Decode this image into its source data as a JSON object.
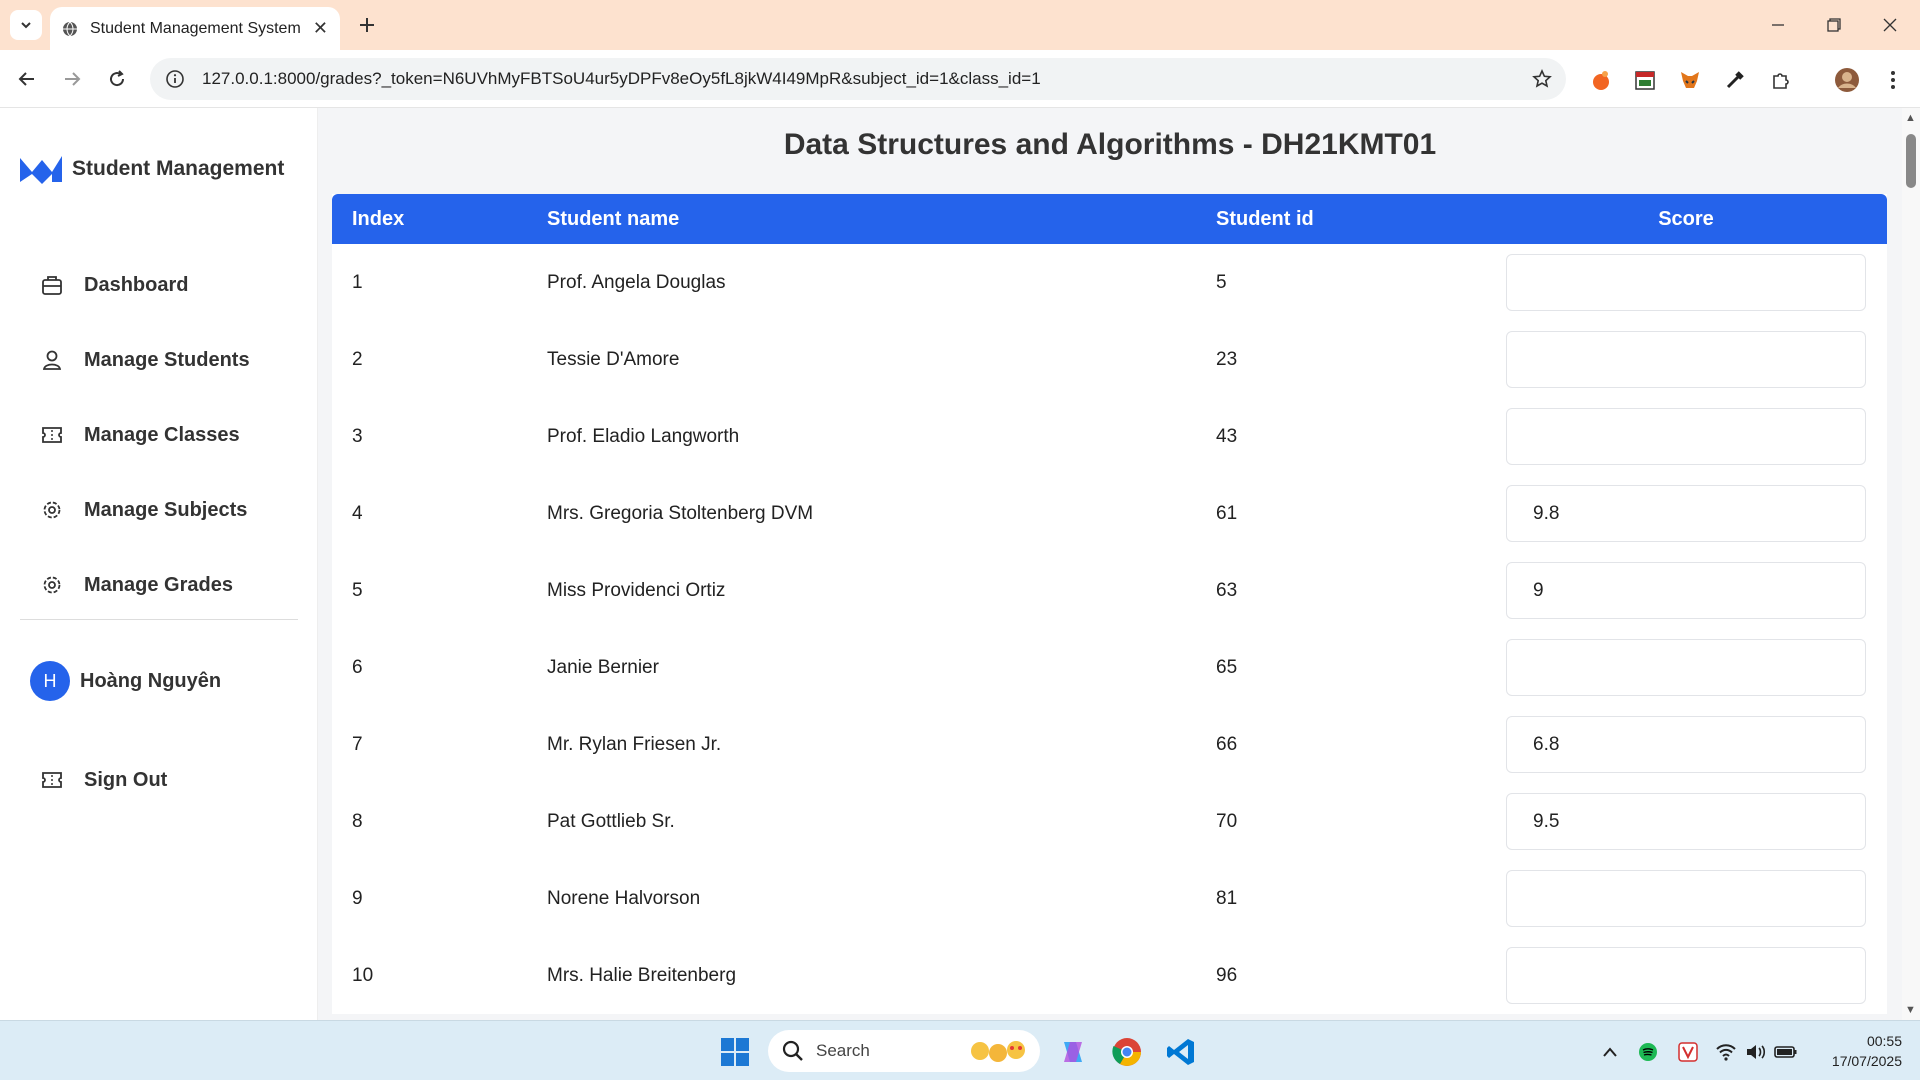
{
  "browser": {
    "tab_title": "Student Management System",
    "url": "127.0.0.1:8000/grades?_token=N6UVhMyFBTSoU4ur5yDPFv8eOy5fL8jkW4I49MpR&subject_id=1&class_id=1"
  },
  "sidebar": {
    "brand": "Student Management",
    "items": [
      {
        "label": "Dashboard",
        "icon": "briefcase-icon"
      },
      {
        "label": "Manage Students",
        "icon": "user-icon"
      },
      {
        "label": "Manage Classes",
        "icon": "ticket-icon"
      },
      {
        "label": "Manage Subjects",
        "icon": "gear-icon"
      },
      {
        "label": "Manage Grades",
        "icon": "gear-icon"
      }
    ],
    "user": {
      "initial": "H",
      "name": "Hoàng Nguyên"
    },
    "signout": "Sign Out"
  },
  "main": {
    "title": "Data Structures and Algorithms - DH21KMT01",
    "columns": [
      "Index",
      "Student name",
      "Student id",
      "Score"
    ],
    "rows": [
      {
        "index": "1",
        "name": "Prof. Angela Douglas",
        "id": "5",
        "score": ""
      },
      {
        "index": "2",
        "name": "Tessie D'Amore",
        "id": "23",
        "score": ""
      },
      {
        "index": "3",
        "name": "Prof. Eladio Langworth",
        "id": "43",
        "score": ""
      },
      {
        "index": "4",
        "name": "Mrs. Gregoria Stoltenberg DVM",
        "id": "61",
        "score": "9.8"
      },
      {
        "index": "5",
        "name": "Miss Providenci Ortiz",
        "id": "63",
        "score": "9"
      },
      {
        "index": "6",
        "name": "Janie Bernier",
        "id": "65",
        "score": ""
      },
      {
        "index": "7",
        "name": "Mr. Rylan Friesen Jr.",
        "id": "66",
        "score": "6.8"
      },
      {
        "index": "8",
        "name": "Pat Gottlieb Sr.",
        "id": "70",
        "score": "9.5"
      },
      {
        "index": "9",
        "name": "Norene Halvorson",
        "id": "81",
        "score": ""
      },
      {
        "index": "10",
        "name": "Mrs. Halie Breitenberg",
        "id": "96",
        "score": ""
      }
    ]
  },
  "taskbar": {
    "search_placeholder": "Search",
    "time": "00:55",
    "date": "17/07/2025"
  },
  "colors": {
    "accent": "#2563eb",
    "tabbar": "#fde2cf",
    "taskbar": "#dcecf6"
  }
}
